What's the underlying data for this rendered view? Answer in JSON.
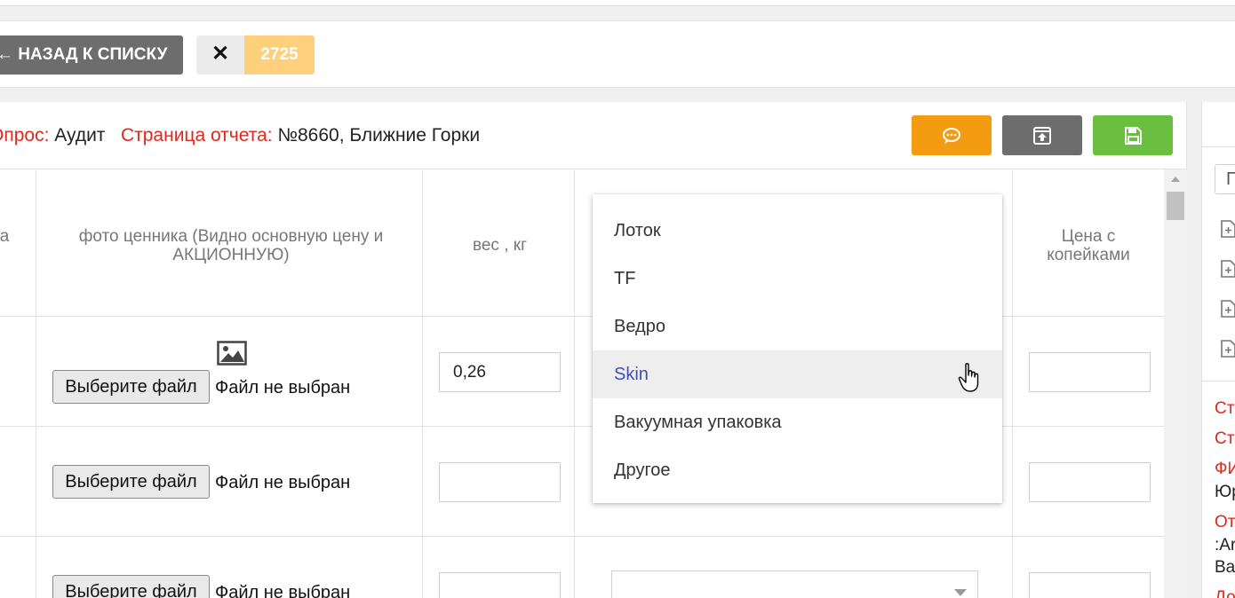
{
  "toolbar": {
    "back_label": "← НАЗАД К СПИСКУ",
    "close_label": "✕",
    "count": "2725"
  },
  "header": {
    "survey_label": "Опрос:",
    "survey_value": "Аудит",
    "page_label": "Страница отчета:",
    "page_value": "№8660, Ближние Горки",
    "comment_icon": "comment-icon",
    "upload_icon": "upload-icon",
    "save_icon": "save-icon"
  },
  "table": {
    "columns": [
      "а",
      "фото ценника (Видно основную цену и АКЦИОННУЮ)",
      "вес , кг",
      "Цена с копейками"
    ],
    "file_button_label": "Выберите файл",
    "file_status": "Файл не выбран",
    "rows": [
      {
        "weight": "0,26",
        "price": ""
      },
      {
        "weight": "",
        "price": ""
      },
      {
        "weight": "",
        "price": ""
      }
    ]
  },
  "dropdown": {
    "options": [
      "Лоток",
      "TF",
      "Ведро",
      "Skin",
      "Вакуумная упаковка",
      "Другое"
    ],
    "highlighted": "Skin"
  },
  "sidebar": {
    "input_value": "П",
    "texts": [
      {
        "text": "Ст",
        "color": "#e2271c"
      },
      {
        "text": "Ст",
        "color": "#e2271c"
      },
      {
        "text": "ФИ",
        "color": "#e2271c"
      },
      {
        "text": "Юр",
        "color": "#222222"
      },
      {
        "text": "От",
        "color": "#e2271c"
      },
      {
        "text": ":Ar",
        "color": "#222222"
      },
      {
        "text": "Ва",
        "color": "#222222"
      },
      {
        "text": "До",
        "color": "#e2271c"
      }
    ]
  },
  "colors": {
    "accent_red": "#e2271c",
    "comment_button": "#f39c12",
    "upload_button": "#6d6d6d",
    "save_button": "#6abf40",
    "count_chip": "#ffd07c",
    "dropdown_highlight_text": "#3f51b5"
  }
}
